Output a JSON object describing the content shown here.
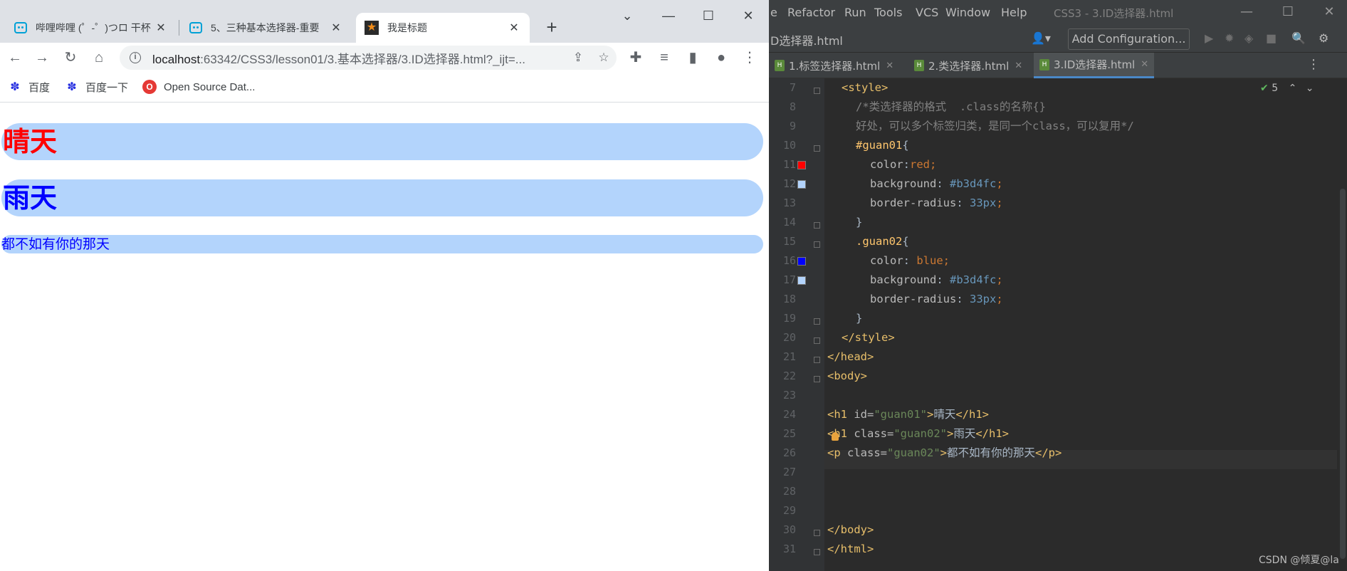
{
  "browser": {
    "tabs": [
      {
        "title": "哔哩哔哩 (゜-゜)つロ 干杯",
        "favicon": "bilibili-icon"
      },
      {
        "title": "5、三种基本选择器-重要",
        "favicon": "bilibili-icon"
      },
      {
        "title": "我是标题",
        "favicon": "star-icon",
        "active": true
      }
    ],
    "url_host": "localhost",
    "url_path": ":63342/CSS3/lesson01/3.基本选择器/3.ID选择器.html?_ijt=...",
    "bookmarks": [
      {
        "label": "百度",
        "icon": "baidu-paw-icon"
      },
      {
        "label": "百度一下",
        "icon": "baidu-paw-icon"
      },
      {
        "label": "Open Source Dat...",
        "icon": "open-source-icon"
      }
    ],
    "page": {
      "h1_sunny": "晴天",
      "h1_rain": "雨天",
      "paragraph": "都不如有你的那天"
    },
    "colors": {
      "highlight_bg": "#b3d4fc",
      "sunny": "#ff0000",
      "rain": "#0000ff"
    }
  },
  "ide": {
    "menu": [
      "e",
      "Refactor",
      "Run",
      "Tools",
      "VCS",
      "Window",
      "Help"
    ],
    "window_title": "CSS3 - 3.ID选择器.html",
    "breadcrumb": "D选择器.html",
    "run_config": "Add Configuration...",
    "editor_tabs": [
      "1.标签选择器.html",
      "2.类选择器.html",
      "3.ID选择器.html"
    ],
    "inspection_count": "5",
    "watermark": "CSDN @倾夏@la",
    "lines": [
      {
        "n": "7"
      },
      {
        "n": "8"
      },
      {
        "n": "9"
      },
      {
        "n": "10"
      },
      {
        "n": "11"
      },
      {
        "n": "12"
      },
      {
        "n": "13"
      },
      {
        "n": "14"
      },
      {
        "n": "15"
      },
      {
        "n": "16"
      },
      {
        "n": "17"
      },
      {
        "n": "18"
      },
      {
        "n": "19"
      },
      {
        "n": "20"
      },
      {
        "n": "21"
      },
      {
        "n": "22"
      },
      {
        "n": "23"
      },
      {
        "n": "24"
      },
      {
        "n": "25"
      },
      {
        "n": "26"
      },
      {
        "n": "27"
      },
      {
        "n": "28"
      },
      {
        "n": "29"
      },
      {
        "n": "30"
      },
      {
        "n": "31"
      }
    ],
    "code": {
      "l7": "<style>",
      "l8": "/*类选择器的格式  .class的名称{}",
      "l9": "好处，可以多个标签归类，是同一个class，可以复用*/",
      "l10_sel": "#guan01",
      "l10_rest": "{",
      "l11_prop": "color",
      "l11_val": "red",
      "l12_prop": "background",
      "l12_val": "#b3d4fc",
      "l13_prop": "border-radius",
      "l13_val": "33px",
      "l14": "}",
      "l15_sel": ".guan02",
      "l15_rest": "{",
      "l16_prop": "color",
      "l16_val": "blue",
      "l17_prop": "background",
      "l17_val": "#b3d4fc",
      "l18_prop": "border-radius",
      "l18_val": "33px",
      "l19": "}",
      "l20": "</style>",
      "l21": "</head>",
      "l22": "<body>",
      "l24_open": "<h1",
      "l24_attr": " id=",
      "l24_val": "\"guan01\"",
      "l24_text": "晴天",
      "l24_close": "</h1>",
      "l25_open": "<h1",
      "l25_attr": " class=",
      "l25_val": "\"guan02\"",
      "l25_text": "雨天",
      "l25_close": "</h1>",
      "l26_open": "<p",
      "l26_attr": " class=",
      "l26_val": "\"guan02\"",
      "l26_text": "都不如有你的那天",
      "l26_close": "</p>",
      "l30": "</body>",
      "l31": "</html>"
    },
    "swatch_colors": {
      "l11": "#ff0000",
      "l12": "#b3d4fc",
      "l16": "#0000ff",
      "l17": "#b3d4fc"
    }
  }
}
